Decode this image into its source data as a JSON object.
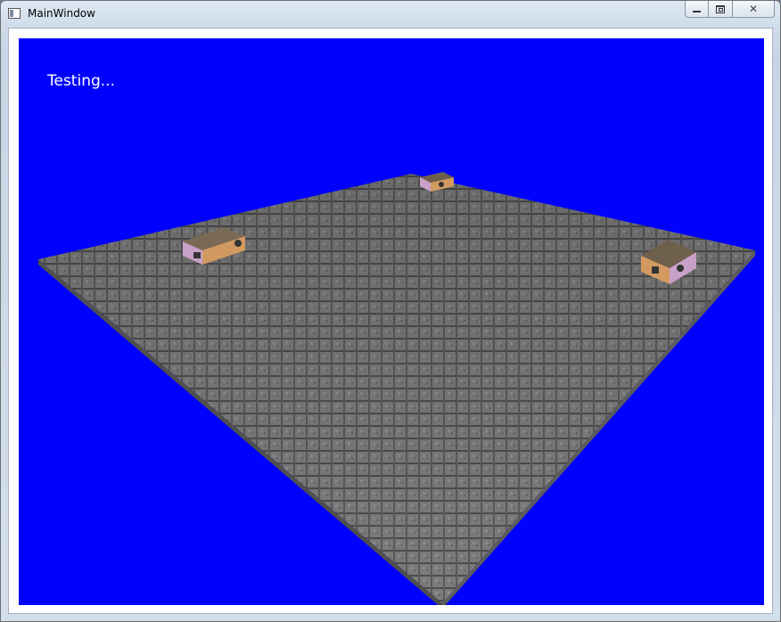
{
  "window": {
    "title": "MainWindow",
    "icon": "window-app-icon"
  },
  "caption_buttons": {
    "minimize_icon": "minimize-icon",
    "maximize_icon": "restore-icon",
    "close_label": "✕",
    "close_icon": "close-icon"
  },
  "viewport": {
    "background_color": "#0000ff",
    "overlay_text": "Testing...",
    "overlay_text_color": "#ffffff"
  },
  "scene": {
    "floor_color": "#7a7a7a",
    "floor_tile_line_color": "#4a4a4a",
    "objects": [
      "textured-cube",
      "textured-cube",
      "textured-cube"
    ]
  }
}
